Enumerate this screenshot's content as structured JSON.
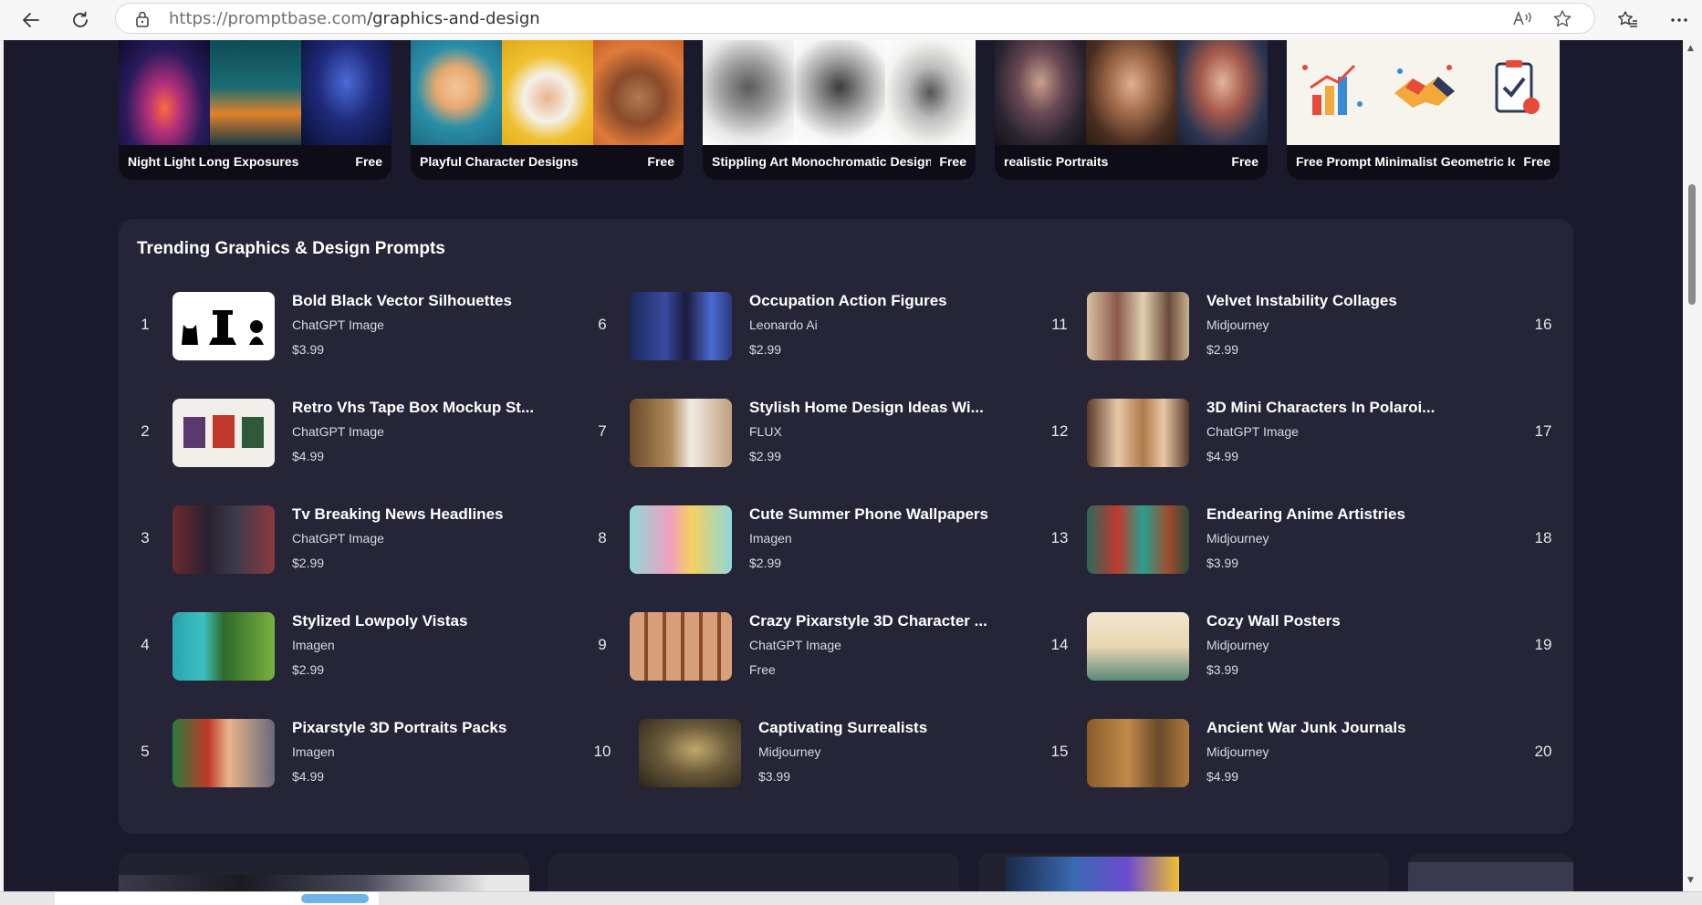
{
  "browser": {
    "url_host": "https://promptbase.com",
    "url_path": "/graphics-and-design",
    "icons": {
      "back": "arrow-left-icon",
      "reload": "reload-icon",
      "lock": "lock-icon",
      "read_aloud": "read-aloud-icon",
      "favorite": "star-icon",
      "favorites_bar": "favorites-list-icon",
      "more": "ellipsis-icon"
    }
  },
  "colors": {
    "page_bg": "#1b1a2c",
    "panel_bg": "#262538",
    "text": "#ffffff",
    "muted_text": "#d9d9de"
  },
  "categories": [
    {
      "title": "Night Light Long Exposures",
      "price": "Free"
    },
    {
      "title": "Playful Character Designs",
      "price": "Free"
    },
    {
      "title": "Stippling Art Monochromatic Designs",
      "price": "Free"
    },
    {
      "title": "realistic Portraits",
      "price": "Free"
    },
    {
      "title": "Free Prompt Minimalist Geometric Ic...",
      "price": "Free"
    }
  ],
  "trending": {
    "heading": "Trending Graphics & Design Prompts",
    "items": [
      {
        "rank": "1",
        "title": "Bold Black Vector Silhouettes",
        "model": "ChatGPT Image",
        "price": "$3.99"
      },
      {
        "rank": "2",
        "title": "Retro Vhs Tape Box Mockup St...",
        "model": "ChatGPT Image",
        "price": "$4.99"
      },
      {
        "rank": "3",
        "title": "Tv Breaking News Headlines",
        "model": "ChatGPT Image",
        "price": "$2.99"
      },
      {
        "rank": "4",
        "title": "Stylized Lowpoly Vistas",
        "model": "Imagen",
        "price": "$2.99"
      },
      {
        "rank": "5",
        "title": "Pixarstyle 3D Portraits Packs",
        "model": "Imagen",
        "price": "$4.99"
      },
      {
        "rank": "6",
        "title": "Occupation Action Figures",
        "model": "Leonardo Ai",
        "price": "$2.99"
      },
      {
        "rank": "7",
        "title": "Stylish Home Design Ideas Wi...",
        "model": "FLUX",
        "price": "$2.99"
      },
      {
        "rank": "8",
        "title": "Cute Summer Phone Wallpapers",
        "model": "Imagen",
        "price": "$2.99"
      },
      {
        "rank": "9",
        "title": "Crazy Pixarstyle 3D Character ...",
        "model": "ChatGPT Image",
        "price": "Free"
      },
      {
        "rank": "10",
        "title": "Captivating Surrealists",
        "model": "Midjourney",
        "price": "$3.99"
      },
      {
        "rank": "11",
        "title": "Velvet Instability Collages",
        "model": "Midjourney",
        "price": "$2.99"
      },
      {
        "rank": "12",
        "title": "3D Mini Characters In Polaroi...",
        "model": "ChatGPT Image",
        "price": "$4.99"
      },
      {
        "rank": "13",
        "title": "Endearing Anime Artistries",
        "model": "Midjourney",
        "price": "$3.99"
      },
      {
        "rank": "14",
        "title": "Cozy Wall Posters",
        "model": "Midjourney",
        "price": "$3.99"
      },
      {
        "rank": "15",
        "title": "Ancient War Junk Journals",
        "model": "Midjourney",
        "price": "$4.99"
      }
    ],
    "trailing_ranks": [
      "16",
      "17",
      "18",
      "19",
      "20"
    ]
  }
}
